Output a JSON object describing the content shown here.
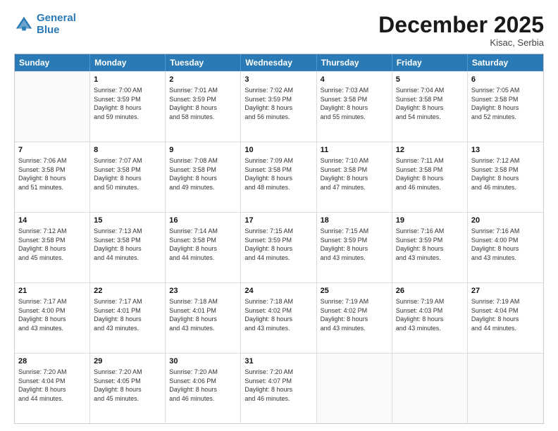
{
  "header": {
    "logo_line1": "General",
    "logo_line2": "Blue",
    "month": "December 2025",
    "location": "Kisac, Serbia"
  },
  "weekdays": [
    "Sunday",
    "Monday",
    "Tuesday",
    "Wednesday",
    "Thursday",
    "Friday",
    "Saturday"
  ],
  "rows": [
    [
      {
        "day": "",
        "info": ""
      },
      {
        "day": "1",
        "info": "Sunrise: 7:00 AM\nSunset: 3:59 PM\nDaylight: 8 hours\nand 59 minutes."
      },
      {
        "day": "2",
        "info": "Sunrise: 7:01 AM\nSunset: 3:59 PM\nDaylight: 8 hours\nand 58 minutes."
      },
      {
        "day": "3",
        "info": "Sunrise: 7:02 AM\nSunset: 3:59 PM\nDaylight: 8 hours\nand 56 minutes."
      },
      {
        "day": "4",
        "info": "Sunrise: 7:03 AM\nSunset: 3:58 PM\nDaylight: 8 hours\nand 55 minutes."
      },
      {
        "day": "5",
        "info": "Sunrise: 7:04 AM\nSunset: 3:58 PM\nDaylight: 8 hours\nand 54 minutes."
      },
      {
        "day": "6",
        "info": "Sunrise: 7:05 AM\nSunset: 3:58 PM\nDaylight: 8 hours\nand 52 minutes."
      }
    ],
    [
      {
        "day": "7",
        "info": "Sunrise: 7:06 AM\nSunset: 3:58 PM\nDaylight: 8 hours\nand 51 minutes."
      },
      {
        "day": "8",
        "info": "Sunrise: 7:07 AM\nSunset: 3:58 PM\nDaylight: 8 hours\nand 50 minutes."
      },
      {
        "day": "9",
        "info": "Sunrise: 7:08 AM\nSunset: 3:58 PM\nDaylight: 8 hours\nand 49 minutes."
      },
      {
        "day": "10",
        "info": "Sunrise: 7:09 AM\nSunset: 3:58 PM\nDaylight: 8 hours\nand 48 minutes."
      },
      {
        "day": "11",
        "info": "Sunrise: 7:10 AM\nSunset: 3:58 PM\nDaylight: 8 hours\nand 47 minutes."
      },
      {
        "day": "12",
        "info": "Sunrise: 7:11 AM\nSunset: 3:58 PM\nDaylight: 8 hours\nand 46 minutes."
      },
      {
        "day": "13",
        "info": "Sunrise: 7:12 AM\nSunset: 3:58 PM\nDaylight: 8 hours\nand 46 minutes."
      }
    ],
    [
      {
        "day": "14",
        "info": "Sunrise: 7:12 AM\nSunset: 3:58 PM\nDaylight: 8 hours\nand 45 minutes."
      },
      {
        "day": "15",
        "info": "Sunrise: 7:13 AM\nSunset: 3:58 PM\nDaylight: 8 hours\nand 44 minutes."
      },
      {
        "day": "16",
        "info": "Sunrise: 7:14 AM\nSunset: 3:58 PM\nDaylight: 8 hours\nand 44 minutes."
      },
      {
        "day": "17",
        "info": "Sunrise: 7:15 AM\nSunset: 3:59 PM\nDaylight: 8 hours\nand 44 minutes."
      },
      {
        "day": "18",
        "info": "Sunrise: 7:15 AM\nSunset: 3:59 PM\nDaylight: 8 hours\nand 43 minutes."
      },
      {
        "day": "19",
        "info": "Sunrise: 7:16 AM\nSunset: 3:59 PM\nDaylight: 8 hours\nand 43 minutes."
      },
      {
        "day": "20",
        "info": "Sunrise: 7:16 AM\nSunset: 4:00 PM\nDaylight: 8 hours\nand 43 minutes."
      }
    ],
    [
      {
        "day": "21",
        "info": "Sunrise: 7:17 AM\nSunset: 4:00 PM\nDaylight: 8 hours\nand 43 minutes."
      },
      {
        "day": "22",
        "info": "Sunrise: 7:17 AM\nSunset: 4:01 PM\nDaylight: 8 hours\nand 43 minutes."
      },
      {
        "day": "23",
        "info": "Sunrise: 7:18 AM\nSunset: 4:01 PM\nDaylight: 8 hours\nand 43 minutes."
      },
      {
        "day": "24",
        "info": "Sunrise: 7:18 AM\nSunset: 4:02 PM\nDaylight: 8 hours\nand 43 minutes."
      },
      {
        "day": "25",
        "info": "Sunrise: 7:19 AM\nSunset: 4:02 PM\nDaylight: 8 hours\nand 43 minutes."
      },
      {
        "day": "26",
        "info": "Sunrise: 7:19 AM\nSunset: 4:03 PM\nDaylight: 8 hours\nand 43 minutes."
      },
      {
        "day": "27",
        "info": "Sunrise: 7:19 AM\nSunset: 4:04 PM\nDaylight: 8 hours\nand 44 minutes."
      }
    ],
    [
      {
        "day": "28",
        "info": "Sunrise: 7:20 AM\nSunset: 4:04 PM\nDaylight: 8 hours\nand 44 minutes."
      },
      {
        "day": "29",
        "info": "Sunrise: 7:20 AM\nSunset: 4:05 PM\nDaylight: 8 hours\nand 45 minutes."
      },
      {
        "day": "30",
        "info": "Sunrise: 7:20 AM\nSunset: 4:06 PM\nDaylight: 8 hours\nand 46 minutes."
      },
      {
        "day": "31",
        "info": "Sunrise: 7:20 AM\nSunset: 4:07 PM\nDaylight: 8 hours\nand 46 minutes."
      },
      {
        "day": "",
        "info": ""
      },
      {
        "day": "",
        "info": ""
      },
      {
        "day": "",
        "info": ""
      }
    ]
  ]
}
